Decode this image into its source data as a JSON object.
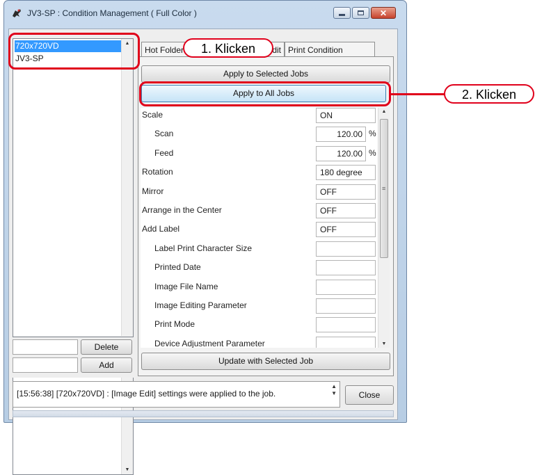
{
  "window": {
    "title": "JV3-SP : Condition Management ( Full Color )"
  },
  "profiles": {
    "items": [
      "720x720VD",
      "JV3-SP"
    ],
    "selected_index": 0
  },
  "left_buttons": {
    "delete": "Delete",
    "add": "Add"
  },
  "tabs": [
    {
      "label": "Hot Folder",
      "active": false
    },
    {
      "label": "Color Edit",
      "active": false
    },
    {
      "label": "Print Condition",
      "active": false
    }
  ],
  "actions": {
    "apply_selected": "Apply to Selected Jobs",
    "apply_all": "Apply to All Jobs",
    "update": "Update with Selected Job"
  },
  "properties": [
    {
      "label": "Scale",
      "value": "ON",
      "indent": 0
    },
    {
      "label": "Scan",
      "value": "120.00",
      "unit": "%",
      "indent": 1
    },
    {
      "label": "Feed",
      "value": "120.00",
      "unit": "%",
      "indent": 1
    },
    {
      "label": "Rotation",
      "value": "180 degree",
      "indent": 0
    },
    {
      "label": "Mirror",
      "value": "OFF",
      "indent": 0
    },
    {
      "label": "Arrange in the Center",
      "value": "OFF",
      "indent": 0
    },
    {
      "label": "Add Label",
      "value": "OFF",
      "indent": 0
    },
    {
      "label": "Label Print Character Size",
      "value": "",
      "indent": 1
    },
    {
      "label": "Printed Date",
      "value": "",
      "indent": 1
    },
    {
      "label": "Image File Name",
      "value": "",
      "indent": 1
    },
    {
      "label": "Image Editing Parameter",
      "value": "",
      "indent": 1
    },
    {
      "label": "Print Mode",
      "value": "",
      "indent": 1
    },
    {
      "label": "Device Adjustment Parameter",
      "value": "",
      "indent": 1
    }
  ],
  "status": {
    "log": "[15:56:38] [720x720VD] : [Image Edit] settings were applied to the job.",
    "close": "Close"
  },
  "annotations": {
    "step1": "1. Klicken",
    "step2": "2. Klicken"
  },
  "colors": {
    "highlight": "#e0001b",
    "selection": "#3399ff"
  }
}
